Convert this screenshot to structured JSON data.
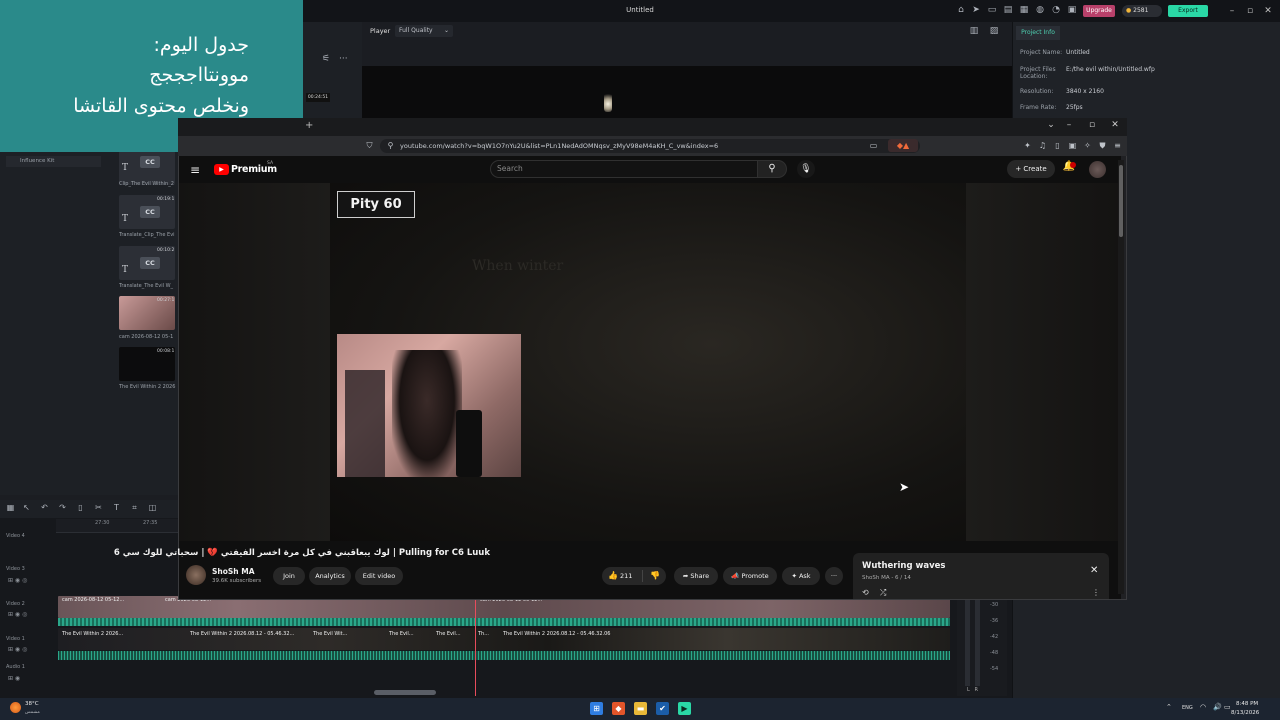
{
  "editor": {
    "title": "Untitled",
    "upgrade": "Upgrade",
    "credits": "2581",
    "export": "Export",
    "player_label": "Player",
    "quality": "Full Quality",
    "project_tab": "Project Info",
    "project_info": [
      {
        "label": "Project Name:",
        "value": "Untitled"
      },
      {
        "label": "Project Files Location:",
        "value": "E:/the evil within/Untitled.wfp"
      },
      {
        "label": "Resolution:",
        "value": "3840 x 2160"
      },
      {
        "label": "Frame Rate:",
        "value": "25fps"
      }
    ],
    "influence_kit": "Influence Kit",
    "thumb_time_top": "00:24:51",
    "media": [
      {
        "name": "Clip_The Evil Within_2",
        "time": "00:19:1"
      },
      {
        "name": "Translate_Clip_The Evi",
        "time": "00:10:2"
      },
      {
        "name": "Translate_The Evil W_",
        "time": "00:27:1"
      },
      {
        "name": "cam 2026-08-12 05-1",
        "time": "00:27:1"
      },
      {
        "name": "The Evil Within 2 2026",
        "time": "00:08:1"
      }
    ],
    "cc_label": "CC",
    "t_label": "T",
    "ruler": [
      "27:30",
      "27:35"
    ],
    "tracks": [
      "Video 4",
      "Video 3",
      "Video 2",
      "Video 1",
      "Audio 1"
    ],
    "clip_labels_v2": [
      "cam 2026-08-12 05-12...",
      "cam 2026-08-12...",
      "cam 2026-08-12 05-12..."
    ],
    "clip_labels_v1": [
      "The Evil Within 2 2026...",
      "The Evil Within 2 2026.08.12 - 05.46.32...",
      "The Evil Wit...",
      "The Evil...",
      "The Evil...",
      "Th...",
      "The Evil Within 2 2026.08.12 - 05.46.32.06"
    ],
    "db_labels": [
      "-30",
      "-36",
      "-42",
      "-48",
      "-54"
    ],
    "lr": "L   R"
  },
  "note": {
    "lines": [
      "جدول اليوم:",
      "موونتااجججج",
      "ونخلص محتوى القاتشا"
    ]
  },
  "browser": {
    "url": "youtube.com/watch?v=bqW1O7nYu2U&list=PLn1NedAdOMNqsv_zMyV98eM4aKH_C_vw&index=6"
  },
  "youtube": {
    "logo": "Premium",
    "logo_sup": "SA",
    "search_placeholder": "Search",
    "create": "Create",
    "pity_text": "Pity 60",
    "ghost_text": "When winter",
    "video_title": "Pulling for C6 Luuk | لوك يبعاقبني في كل مرة اخسر الفيفتي 💔 | سحباتي للوك سي 6",
    "channel_name": "ShoSh MA",
    "channel_subs": "39.6K subscribers",
    "join": "Join",
    "analytics": "Analytics",
    "edit_video": "Edit video",
    "likes": "211",
    "share": "Share",
    "promote": "Promote",
    "ask": "Ask",
    "more": "···"
  },
  "playlist": {
    "title": "Wuthering waves",
    "sub": "ShoSh MA - 6 / 14"
  },
  "taskbar": {
    "temp": "38°C",
    "weather": "مشمس",
    "lang": "ENG",
    "time": "8:48 PM",
    "date": "8/13/2026"
  },
  "colors": {
    "note_bg": "#2a8a8a",
    "export": "#2ad8a6",
    "upgrade": "#b8406a",
    "playhead": "#e74c5c",
    "yt_red": "#ff0000"
  }
}
